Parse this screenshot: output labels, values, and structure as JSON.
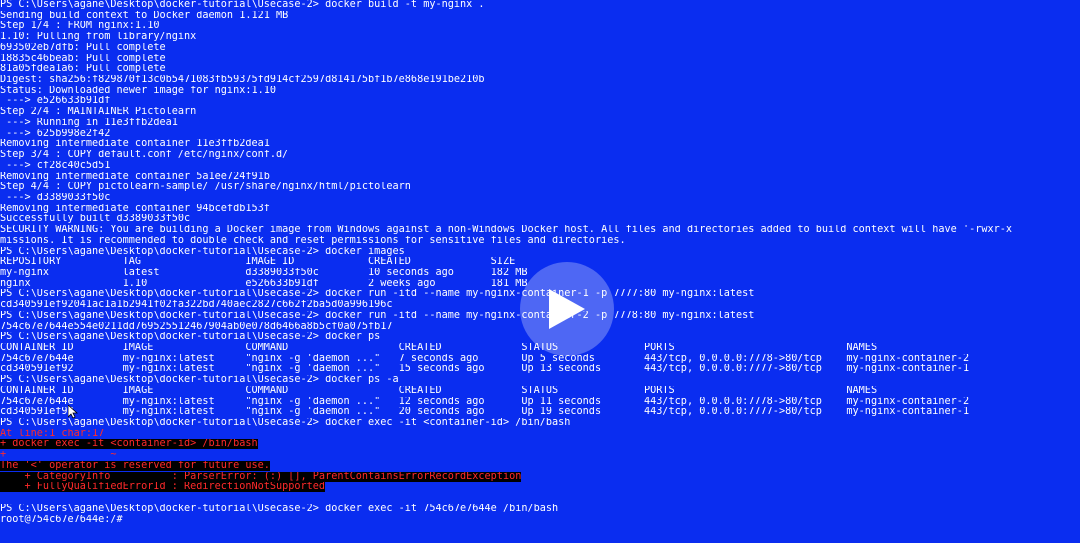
{
  "terminal": {
    "lines": [
      {
        "text": "PS C:\\Users\\agane\\Desktop\\docker-tutorial\\Usecase-2> docker build -t my-nginx ."
      },
      {
        "text": "Sending build context to Docker daemon 1.121 MB"
      },
      {
        "text": "Step 1/4 : FROM nginx:1.10"
      },
      {
        "text": "1.10: Pulling from library/nginx"
      },
      {
        "text": "693502eb7dfb: Pull complete"
      },
      {
        "text": "18835c46beab: Pull complete"
      },
      {
        "text": "81a05fdea1a6: Pull complete"
      },
      {
        "text": "Digest: sha256:f829870f13c0b5471083fb59375fd914cf2597d814175bf1b7e868e191be210b"
      },
      {
        "text": "Status: Downloaded newer image for nginx:1.10"
      },
      {
        "text": " ---> e526633b91df"
      },
      {
        "text": "Step 2/4 : MAINTAINER Pictolearn"
      },
      {
        "text": " ---> Running in 11e3ffb2dea1"
      },
      {
        "text": " ---> 625b998e2f42"
      },
      {
        "text": "Removing intermediate container 11e3ffb2dea1"
      },
      {
        "text": "Step 3/4 : COPY default.conf /etc/nginx/conf.d/"
      },
      {
        "text": " ---> cf28c40c5d51"
      },
      {
        "text": "Removing intermediate container 5a1ee724f91b"
      },
      {
        "text": "Step 4/4 : COPY pictolearn-sample/ /usr/share/nginx/html/pictolearn"
      },
      {
        "text": " ---> d3389033f50c"
      },
      {
        "text": "Removing intermediate container 94bcefdb153f"
      },
      {
        "text": "Successfully built d3389033f50c"
      },
      {
        "text": "SECURITY WARNING: You are building a Docker image from Windows against a non-Windows Docker host. All files and directories added to build context will have '-rwxr-x"
      },
      {
        "text": "missions. It is recommended to double check and reset permissions for sensitive files and directories."
      },
      {
        "text": "PS C:\\Users\\agane\\Desktop\\docker-tutorial\\Usecase-2> docker images"
      },
      {
        "text": "REPOSITORY          TAG                 IMAGE ID            CREATED             SIZE"
      },
      {
        "text": "my-nginx            latest              d3389033f50c        10 seconds ago      182 MB"
      },
      {
        "text": "nginx               1.10                e526633b91df        2 weeks ago         181 MB"
      },
      {
        "text": "PS C:\\Users\\agane\\Desktop\\docker-tutorial\\Usecase-2> docker run -itd --name my-nginx-container-1 -p 7777:80 my-nginx:latest"
      },
      {
        "text": "cd340591ef92041ac1a1b2941f02fa322bd740aec2827c662f2ba5d0a996196c"
      },
      {
        "text": "PS C:\\Users\\agane\\Desktop\\docker-tutorial\\Usecase-2> docker run -itd --name my-nginx-container-2 -p 7778:80 my-nginx:latest"
      },
      {
        "text": "754c67e7644e554e0211dd769525512467904ab0e078d6466a8b5cf0a075fb17"
      },
      {
        "text": "PS C:\\Users\\agane\\Desktop\\docker-tutorial\\Usecase-2> docker ps"
      },
      {
        "text": "CONTAINER ID        IMAGE               COMMAND                  CREATED             STATUS              PORTS                            NAMES"
      },
      {
        "text": "754c67e7644e        my-nginx:latest     \"nginx -g 'daemon ...\"   7 seconds ago       Up 5 seconds        443/tcp, 0.0.0.0:7778->80/tcp    my-nginx-container-2"
      },
      {
        "text": "cd340591ef92        my-nginx:latest     \"nginx -g 'daemon ...\"   15 seconds ago      Up 13 seconds       443/tcp, 0.0.0.0:7777->80/tcp    my-nginx-container-1"
      },
      {
        "text": "PS C:\\Users\\agane\\Desktop\\docker-tutorial\\Usecase-2> docker ps -a"
      },
      {
        "text": "CONTAINER ID        IMAGE               COMMAND                  CREATED             STATUS              PORTS                            NAMES"
      },
      {
        "text": "754c67e7644e        my-nginx:latest     \"nginx -g 'daemon ...\"   12 seconds ago      Up 11 seconds       443/tcp, 0.0.0.0:7778->80/tcp    my-nginx-container-2"
      },
      {
        "text": "cd340591ef92        my-nginx:latest     \"nginx -g 'daemon ...\"   20 seconds ago      Up 19 seconds       443/tcp, 0.0.0.0:7777->80/tcp    my-nginx-container-1"
      },
      {
        "text": "PS C:\\Users\\agane\\Desktop\\docker-tutorial\\Usecase-2> docker exec -it <container-id> /bin/bash"
      },
      {
        "text": "At line:1 char:17",
        "error": true
      },
      {
        "text": "+ docker exec -it <container-id> /bin/bash",
        "error": true,
        "highlight": true
      },
      {
        "text": "+                 ~",
        "error": true
      },
      {
        "text": "The '<' operator is reserved for future use.",
        "error": true,
        "highlight": true
      },
      {
        "text": "    + CategoryInfo          : ParserError: (:) [], ParentContainsErrorRecordException",
        "error": true,
        "highlight": true
      },
      {
        "text": "    + FullyQualifiedErrorId : RedirectionNotSupported",
        "error": true,
        "highlight": true
      },
      {
        "text": ""
      },
      {
        "text": "PS C:\\Users\\agane\\Desktop\\docker-tutorial\\Usecase-2> docker exec -it 754c67e7644e /bin/bash"
      },
      {
        "text": "root@754c67e7644e:/#"
      }
    ]
  },
  "overlay": {
    "play_icon": "play-icon",
    "cursor_icon": "mouse-pointer-icon"
  },
  "colors": {
    "background": "#0a2df0",
    "text": "#ffffff",
    "error_text": "#ff2a2a",
    "error_highlight_bg": "#000000"
  }
}
